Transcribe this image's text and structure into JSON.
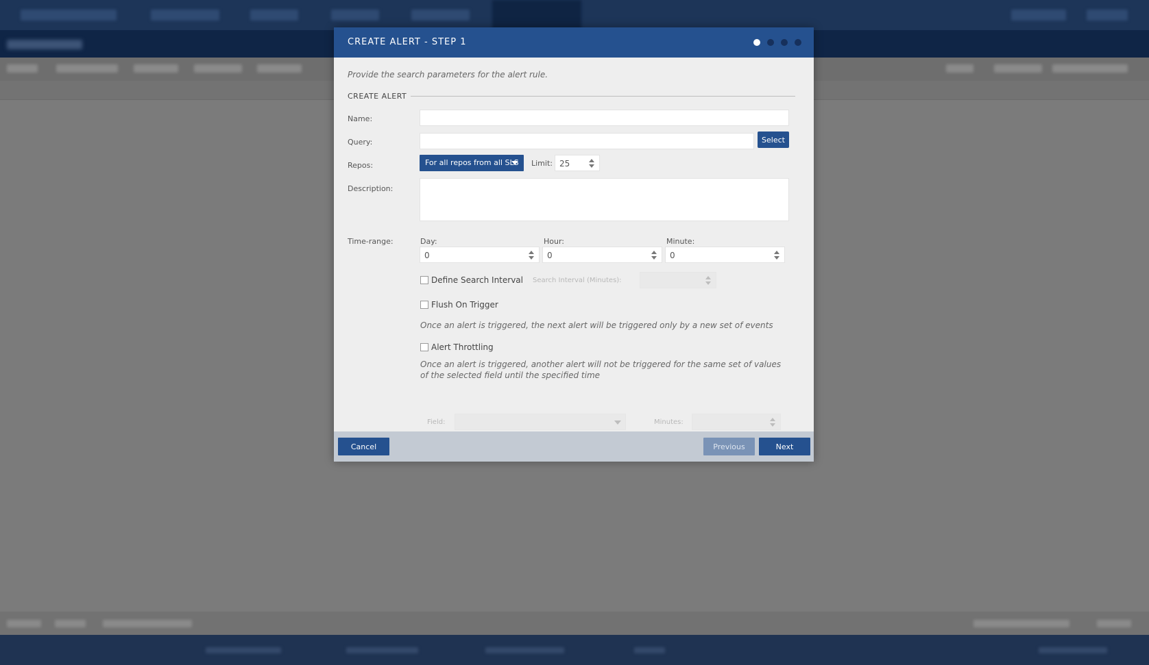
{
  "modal": {
    "title": "CREATE ALERT - STEP 1",
    "intro": "Provide the search parameters for the alert rule.",
    "section_title": "CREATE ALERT",
    "steps_total": 4,
    "step_current": 1
  },
  "form": {
    "name_label": "Name:",
    "name_value": "",
    "query_label": "Query:",
    "query_value": "",
    "select_button": "Select",
    "repos_label": "Repos:",
    "repos_value": "For all repos from all SLS",
    "limit_label": "Limit:",
    "limit_value": "25",
    "description_label": "Description:",
    "description_value": "",
    "time_range_label": "Time-range:",
    "day_label": "Day:",
    "day_value": "0",
    "hour_label": "Hour:",
    "hour_value": "0",
    "minute_label": "Minute:",
    "minute_value": "0",
    "define_interval_label": "Define Search Interval",
    "search_interval_label": "Search Interval (Minutes):",
    "flush_label": "Flush On Trigger",
    "flush_help": "Once an alert is triggered, the next alert will be triggered only by a new set of events",
    "throttling_label": "Alert Throttling",
    "throttling_help": "Once an alert is triggered, another alert will not be triggered for the same set of values of the selected field until the specified time",
    "field_label": "Field:",
    "minutes_label": "Minutes:"
  },
  "footer": {
    "cancel": "Cancel",
    "previous": "Previous",
    "next": "Next"
  },
  "colors": {
    "primary": "#25518f",
    "footer_bg": "#c3cad3",
    "overlay": "#7b7b7b"
  }
}
